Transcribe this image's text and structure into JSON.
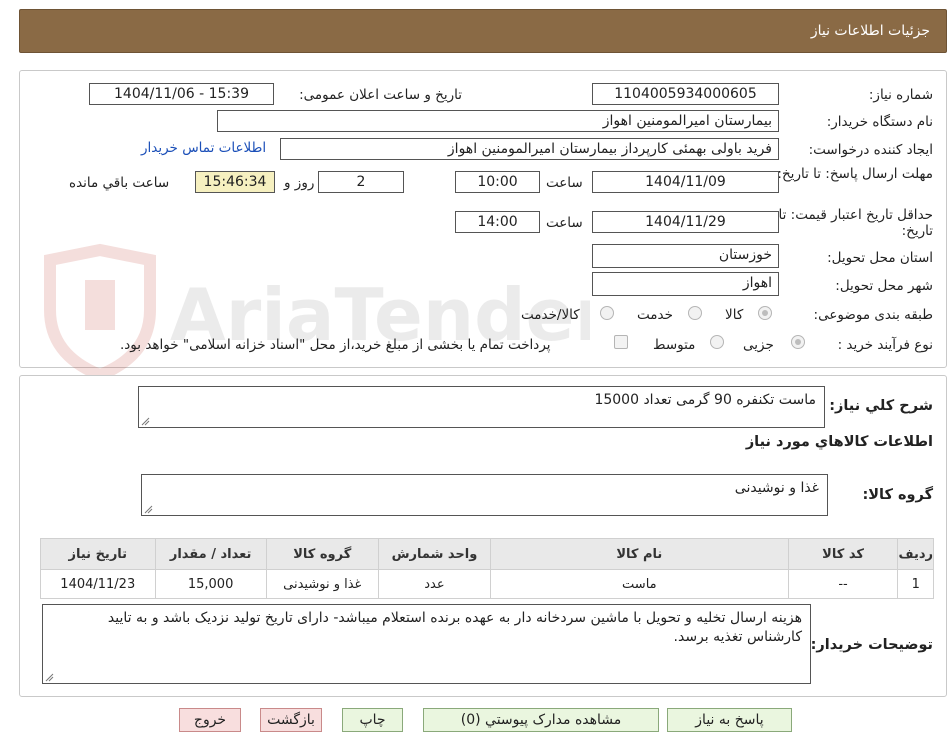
{
  "header": {
    "title": "جزئیات اطلاعات نیاز"
  },
  "watermark": {
    "text": "AriaTender.neT"
  },
  "form": {
    "need_number": {
      "label": "شماره نیاز:",
      "value": "1104005934000605"
    },
    "announce_datetime": {
      "label": "تاریخ و ساعت اعلان عمومی:",
      "value": "1404/11/06 - 15:39"
    },
    "buyer_org": {
      "label": "نام دستگاه خریدار:",
      "value": "بیمارستان امیرالمومنین اهواز"
    },
    "requester": {
      "label": "ایجاد کننده درخواست:",
      "value": "فرید باولی بهمئی کارپرداز بیمارستان امیرالمومنین اهواز",
      "contact_link": "اطلاعات تماس خریدار"
    },
    "reply_deadline": {
      "label": "مهلت ارسال پاسخ: تا تاریخ:",
      "date": "1404/11/09",
      "time_label": "ساعت",
      "time": "10:00",
      "days": "2",
      "days_label": "روز و",
      "remaining": "15:46:34",
      "remaining_label": "ساعت باقي مانده"
    },
    "price_validity": {
      "label": "حداقل تاریخ اعتبار قیمت: تا تاریخ:",
      "date": "1404/11/29",
      "time_label": "ساعت",
      "time": "14:00"
    },
    "province": {
      "label": "استان محل تحویل:",
      "value": "خوزستان"
    },
    "city": {
      "label": "شهر محل تحویل:",
      "value": "اهواز"
    },
    "category": {
      "label": "طبقه بندی موضوعی:",
      "options": [
        "کالا",
        "خدمت",
        "کالا/خدمت"
      ],
      "selected": "کالا"
    },
    "process_type": {
      "label": "نوع فرآیند خرید :",
      "options": [
        "جزیی",
        "متوسط"
      ],
      "selected": "جزیی",
      "treasury_note": "پرداخت تمام یا بخشی از مبلغ خرید،از محل \"اسناد خزانه اسلامی\" خواهد بود."
    }
  },
  "details": {
    "summary_label": "شرح کلي نياز:",
    "summary_value": "ماست تکنفره 90 گرمی تعداد 15000",
    "goods_info_title": "اطلاعات کالاهاي مورد نياز",
    "goods_group_label": "گروه کالا:",
    "goods_group_value": "غذا و نوشیدنی",
    "table": {
      "headers": [
        "رديف",
        "کد کالا",
        "نام کالا",
        "واحد شمارش",
        "گروه کالا",
        "تعداد / مقدار",
        "تاریخ نیاز"
      ],
      "rows": [
        [
          "1",
          "--",
          "ماست",
          "عدد",
          "غذا و نوشیدنی",
          "15,000",
          "1404/11/23"
        ]
      ]
    },
    "buyer_notes_label": "توضیحات خریدار:",
    "buyer_notes_value": "هزینه ارسال تخلیه و تحویل با ماشین سردخانه دار به عهده برنده استعلام میباشد- دارای تاریخ تولید نزدیک باشد و به تایید کارشناس تغذیه برسد."
  },
  "buttons": {
    "reply": "پاسخ به نیاز",
    "attachments": "مشاهده مدارک پیوستي (0)",
    "print": "چاپ",
    "back": "بازگشت",
    "exit": "خروج"
  }
}
